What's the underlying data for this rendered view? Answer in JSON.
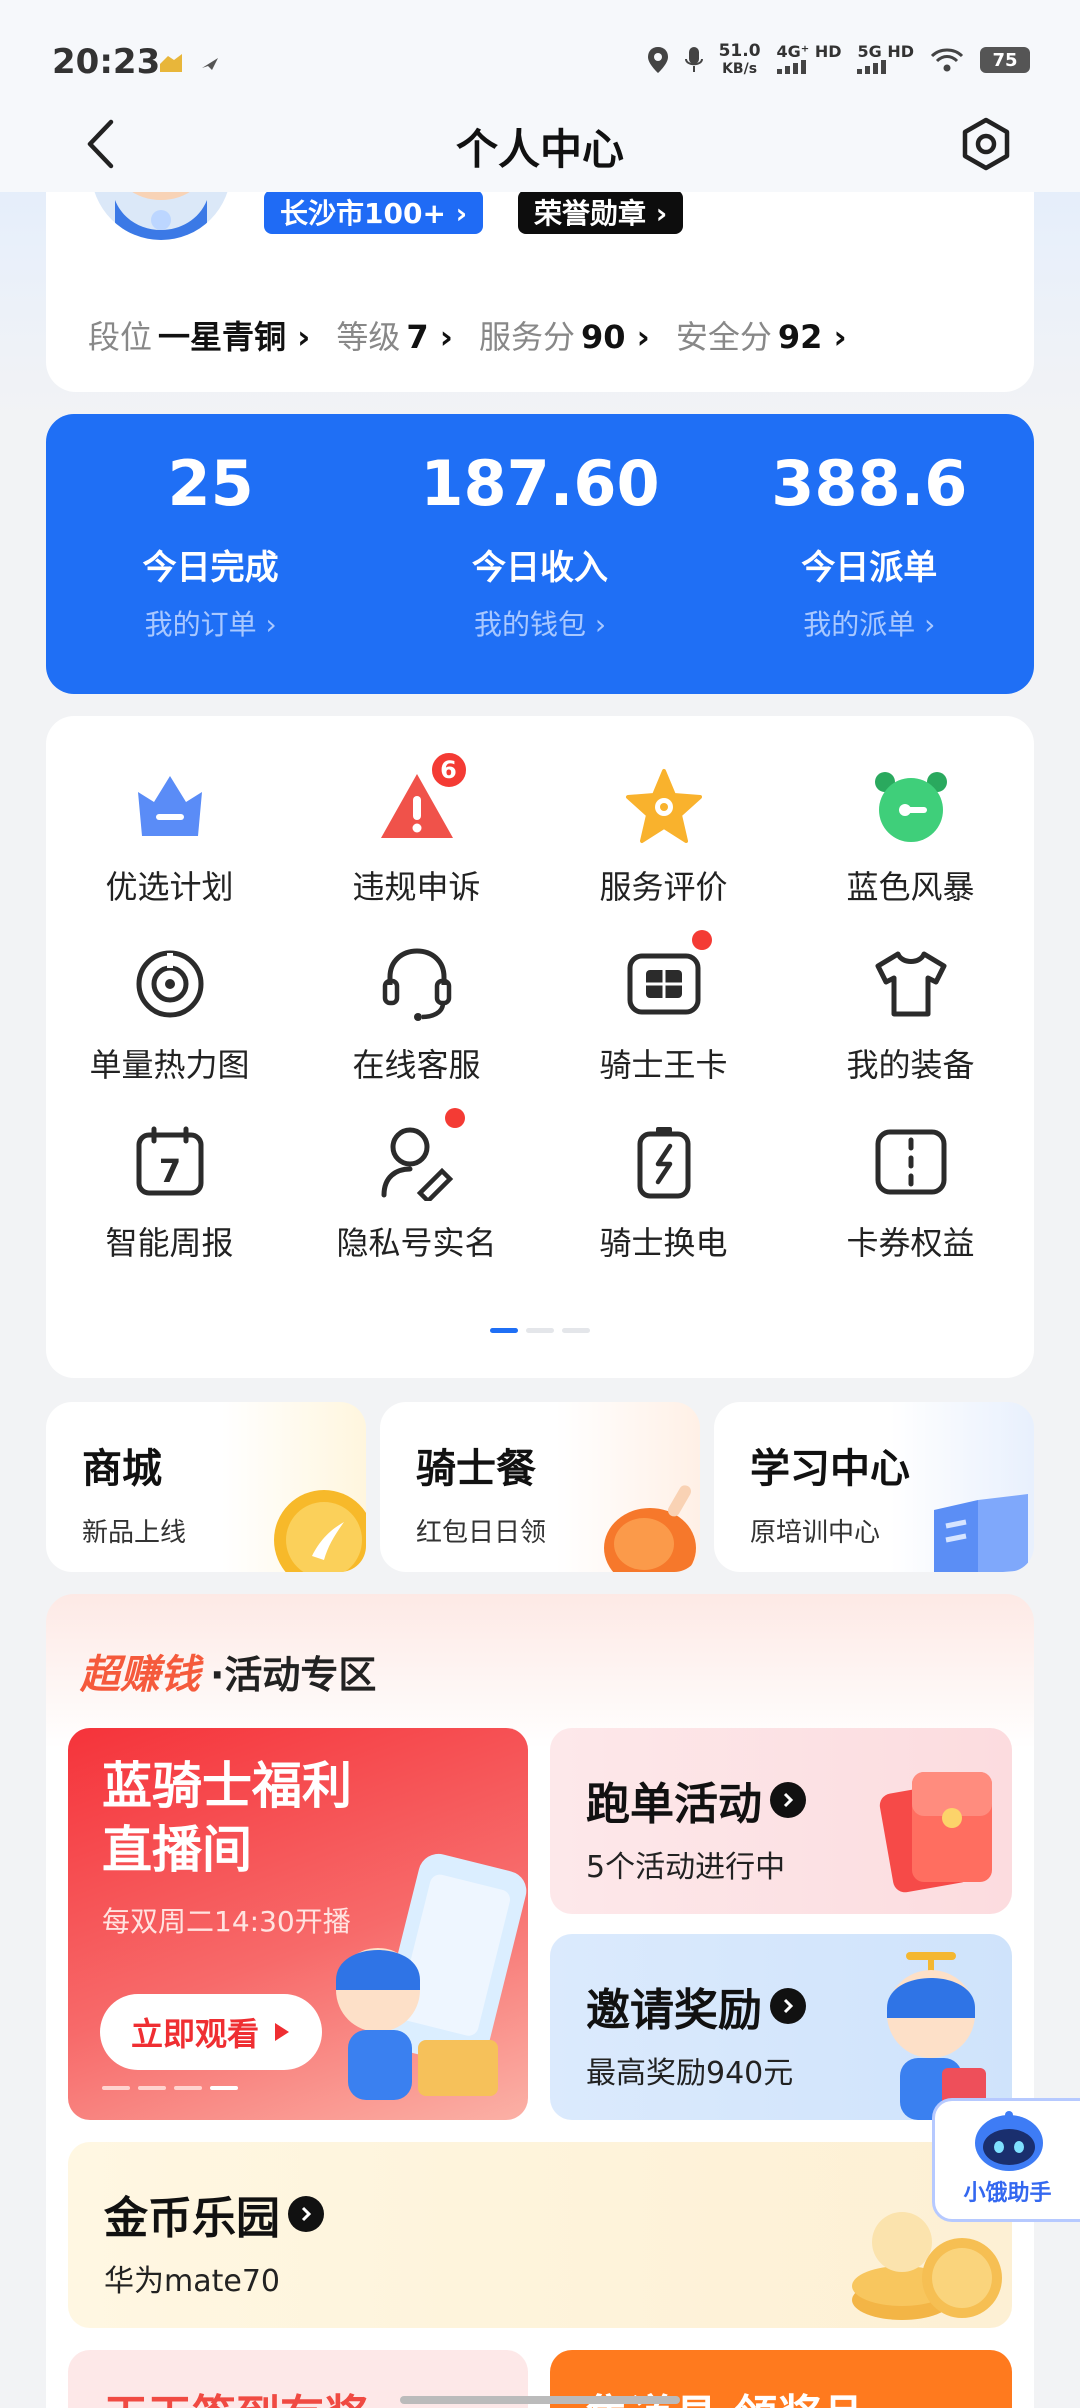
{
  "status_bar": {
    "time": "20:23",
    "speed_value": "51.0",
    "speed_unit": "KB/s",
    "net1": "4G⁺ HD",
    "net2": "5G HD",
    "battery": "75"
  },
  "header": {
    "title": "个人中心"
  },
  "profile": {
    "city_badge": "长沙市100+ ›",
    "honor_badge": "荣誉勋章 ›",
    "stats": [
      {
        "label": "段位",
        "value": "一星青铜 ›"
      },
      {
        "label": "等级",
        "value": "7 ›"
      },
      {
        "label": "服务分",
        "value": "90 ›"
      },
      {
        "label": "安全分",
        "value": "92 ›"
      }
    ]
  },
  "summary": [
    {
      "value": "25",
      "label": "今日完成",
      "link": "我的订单 ›"
    },
    {
      "value": "187.60",
      "label": "今日收入",
      "link": "我的钱包 ›"
    },
    {
      "value": "388.6",
      "label": "今日派单",
      "link": "我的派单 ›"
    }
  ],
  "grid": [
    {
      "label": "优选计划",
      "icon": "crown-icon"
    },
    {
      "label": "违规申诉",
      "icon": "warning-icon",
      "badge": "6"
    },
    {
      "label": "服务评价",
      "icon": "star-icon"
    },
    {
      "label": "蓝色风暴",
      "icon": "alarm-clock-icon"
    },
    {
      "label": "单量热力图",
      "icon": "target-icon"
    },
    {
      "label": "在线客服",
      "icon": "headset-icon"
    },
    {
      "label": "骑士王卡",
      "icon": "sim-card-icon",
      "dot": true
    },
    {
      "label": "我的装备",
      "icon": "tshirt-icon"
    },
    {
      "label": "智能周报",
      "icon": "calendar-icon",
      "icon_text": "7"
    },
    {
      "label": "隐私号实名",
      "icon": "user-edit-icon",
      "dot": true
    },
    {
      "label": "骑士换电",
      "icon": "battery-swap-icon"
    },
    {
      "label": "卡券权益",
      "icon": "coupon-icon"
    }
  ],
  "shortcuts": [
    {
      "title": "商城",
      "sub": "新品上线"
    },
    {
      "title": "骑士餐",
      "sub": "红包日日领"
    },
    {
      "title": "学习中心",
      "sub": "原培训中心"
    }
  ],
  "activity": {
    "brand": "超赚钱",
    "title": "·活动专区",
    "live": {
      "title_line1": "蓝骑士福利",
      "title_line2": "直播间",
      "sub": "每双周二14:30开播",
      "button": "立即观看"
    },
    "run": {
      "title": "跑单活动",
      "sub": "5个活动进行中"
    },
    "invite": {
      "title": "邀请奖励",
      "sub": "最高奖励940元"
    },
    "coin": {
      "title": "金币乐园",
      "sub": "华为mate70"
    },
    "peek_left": "天天签到有奖",
    "peek_right": "集道具 领奖品"
  },
  "assistant": {
    "label": "小饿助手"
  },
  "colors": {
    "brand_blue": "#1f6ff5",
    "badge_red": "#f43b34"
  }
}
